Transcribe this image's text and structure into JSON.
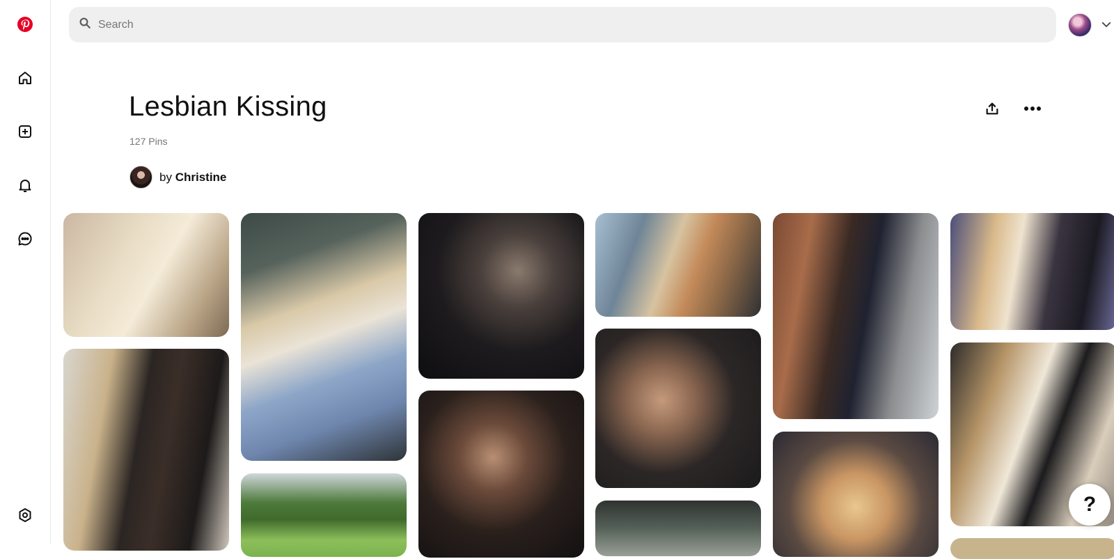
{
  "nav": {
    "logo_icon": "pinterest-logo-icon",
    "items": [
      {
        "icon": "home-icon"
      },
      {
        "icon": "create-icon"
      },
      {
        "icon": "notifications-icon"
      },
      {
        "icon": "messages-icon"
      }
    ],
    "settings_icon": "settings-icon"
  },
  "search": {
    "placeholder": "Search"
  },
  "board": {
    "title": "Lesbian Kissing",
    "pin_count": "127 Pins",
    "owner_prefix": "by",
    "owner_name": "Christine"
  },
  "colors": {
    "brand": "#e60023",
    "text": "#111111",
    "muted": "#767676"
  },
  "help_label": "?"
}
